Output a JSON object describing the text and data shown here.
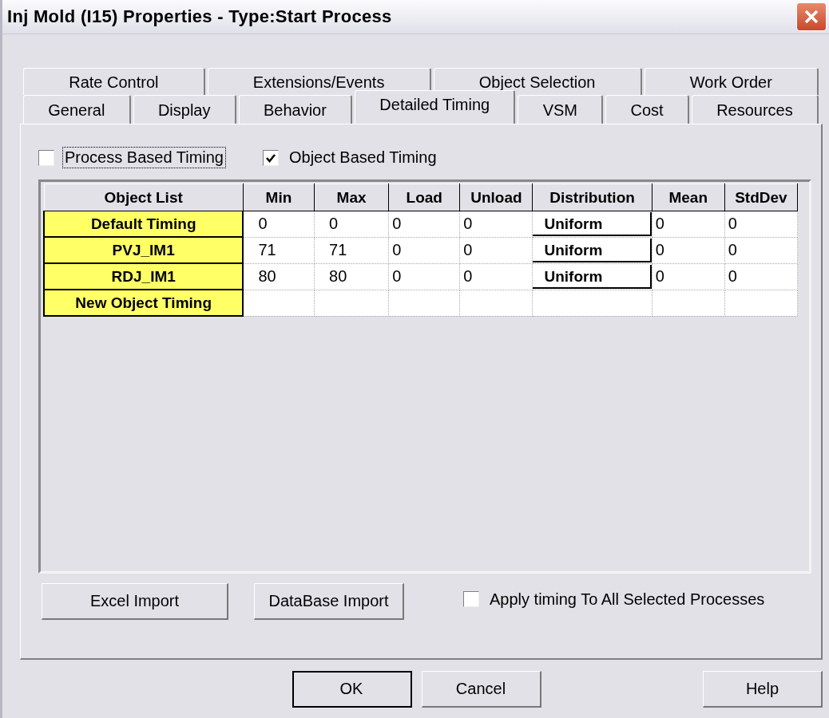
{
  "window": {
    "title": "Inj Mold (I15) Properties - Type:Start Process"
  },
  "tab_rows": [
    {
      "tabs": [
        {
          "label": "Rate Control",
          "selected": false
        },
        {
          "label": "Extensions/Events",
          "selected": false
        },
        {
          "label": "Object Selection",
          "selected": false
        },
        {
          "label": "Work Order",
          "selected": false
        }
      ]
    },
    {
      "tabs": [
        {
          "label": "General",
          "selected": false
        },
        {
          "label": "Display",
          "selected": false
        },
        {
          "label": "Behavior",
          "selected": false
        },
        {
          "label": "Detailed Timing",
          "selected": true
        },
        {
          "label": "VSM",
          "selected": false
        },
        {
          "label": "Cost",
          "selected": false
        },
        {
          "label": "Resources",
          "selected": false
        }
      ]
    }
  ],
  "options": [
    {
      "label": "Process Based Timing",
      "checked": false,
      "focused": true
    },
    {
      "label": "Object Based Timing",
      "checked": true,
      "focused": false
    }
  ],
  "table": {
    "columns": [
      {
        "label": "Object List"
      },
      {
        "label": "Min",
        "kind": "number"
      },
      {
        "label": "Max",
        "kind": "number"
      },
      {
        "label": "Load",
        "kind": "text"
      },
      {
        "label": "Unload",
        "kind": "text"
      },
      {
        "label": "Distribution",
        "kind": "choice"
      },
      {
        "label": "Mean",
        "kind": "text"
      },
      {
        "label": "StdDev",
        "kind": "text"
      }
    ],
    "rows": [
      {
        "object": "Default Timing",
        "cells": [
          "0",
          "0",
          "0",
          "0",
          "Uniform",
          "0",
          "0"
        ]
      },
      {
        "object": "PVJ_IM1",
        "cells": [
          "71",
          "71",
          "0",
          "0",
          "Uniform",
          "0",
          "0"
        ]
      },
      {
        "object": "RDJ_IM1",
        "cells": [
          "80",
          "80",
          "0",
          "0",
          "Uniform",
          "0",
          "0"
        ]
      },
      {
        "object": "New Object Timing"
      }
    ]
  },
  "import_buttons": [
    "Excel Import",
    "DataBase Import"
  ],
  "apply_all": {
    "label": "Apply timing To All Selected Processes",
    "checked": false
  },
  "dialog_buttons": [
    {
      "label": "OK",
      "default": true
    },
    {
      "label": "Cancel",
      "default": false
    }
  ],
  "help_button": "Help"
}
